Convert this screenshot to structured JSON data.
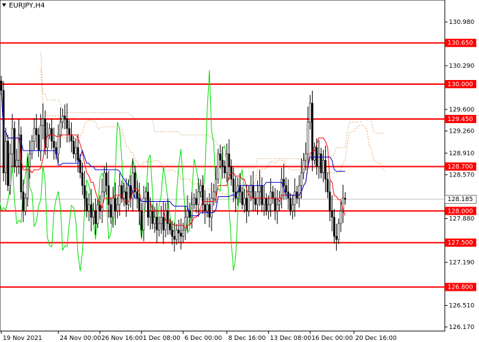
{
  "chart_data": {
    "type": "candlestick",
    "symbol_title": "EURJPY,H4",
    "y_axis": {
      "min": 126.17,
      "max": 131.1,
      "tick_labels": [
        "130.980",
        "130.650",
        "130.290",
        "129.950",
        "129.600",
        "129.260",
        "128.910",
        "128.570",
        "128.220",
        "127.880",
        "127.530",
        "127.190",
        "126.850",
        "126.510",
        "126.170"
      ],
      "side": "right"
    },
    "x_axis": {
      "tick_labels": [
        {
          "label": "19 Nov 2021",
          "index": 0
        },
        {
          "label": "24 Nov 00:00",
          "index": 26
        },
        {
          "label": "26 Nov 16:00",
          "index": 45
        },
        {
          "label": "1 Dec 08:00",
          "index": 64
        },
        {
          "label": "6 Dec 00:00",
          "index": 83
        },
        {
          "label": "8 Dec 16:00",
          "index": 103
        },
        {
          "label": "13 Dec 08:00",
          "index": 122
        },
        {
          "label": "16 Dec 00:00",
          "index": 141
        },
        {
          "label": "20 Dec 16:00",
          "index": 161
        }
      ]
    },
    "levels": [
      {
        "value": 130.65,
        "label": "130.650",
        "color": "#ff0000"
      },
      {
        "value": 130.0,
        "label": "130.000",
        "color": "#ff0000"
      },
      {
        "value": 129.45,
        "label": "129.450",
        "color": "#ff0000"
      },
      {
        "value": 128.7,
        "label": "128.700",
        "color": "#ff0000"
      },
      {
        "value": 128.0,
        "label": "128.000",
        "color": "#ff0000"
      },
      {
        "value": 127.5,
        "label": "127.500",
        "color": "#ff0000"
      },
      {
        "value": 126.8,
        "label": "126.800",
        "color": "#ff0000"
      }
    ],
    "current_price": {
      "value": 128.185,
      "label": "128.185"
    },
    "candle_closes": [
      129.9,
      128.6,
      129.1,
      128.4,
      128.9,
      129.3,
      128.7,
      128.8,
      129.2,
      128.3,
      128.0,
      128.2,
      128.7,
      128.9,
      129.1,
      129.3,
      129.2,
      128.95,
      129.35,
      129.45,
      129.0,
      129.2,
      129.3,
      129.1,
      129.0,
      128.9,
      129.2,
      129.4,
      129.5,
      129.45,
      129.3,
      129.2,
      129.1,
      128.9,
      129.0,
      128.8,
      128.6,
      128.4,
      128.2,
      128.0,
      128.1,
      127.9,
      128.0,
      127.8,
      128.1,
      128.0,
      128.3,
      128.6,
      128.4,
      128.1,
      127.9,
      128.2,
      128.0,
      128.1,
      128.4,
      128.2,
      128.3,
      128.1,
      128.4,
      128.2,
      128.6,
      128.3,
      128.2,
      128.0,
      127.7,
      128.2,
      128.3,
      127.9,
      128.0,
      127.8,
      127.9,
      127.7,
      127.8,
      127.9,
      127.7,
      128.0,
      127.8,
      127.7,
      127.6,
      127.55,
      127.7,
      127.65,
      127.6,
      127.7,
      127.9,
      128.0,
      127.9,
      128.1,
      128.2,
      128.1,
      128.3,
      128.4,
      128.1,
      128.0,
      128.1,
      127.9,
      128.2,
      128.3,
      128.5,
      128.9,
      128.8,
      128.7,
      128.6,
      128.9,
      128.7,
      128.5,
      128.3,
      128.2,
      128.4,
      128.3,
      128.1,
      128.2,
      128.0,
      128.3,
      128.4,
      128.2,
      128.1,
      128.3,
      128.4,
      128.1,
      128.2,
      128.0,
      128.1,
      128.3,
      128.2,
      128.0,
      128.1,
      128.2,
      128.5,
      128.4,
      128.3,
      128.2,
      128.0,
      128.1,
      128.3,
      128.2,
      128.4,
      128.6,
      128.8,
      128.9,
      129.4,
      129.7,
      128.8,
      129.0,
      128.7,
      128.9,
      128.6,
      128.8,
      128.5,
      128.3,
      128.0,
      127.9,
      127.6,
      127.55,
      127.8,
      128.0,
      128.2,
      128.185
    ],
    "series": [
      {
        "name": "tenkan",
        "color": "#ff0000"
      },
      {
        "name": "kijun",
        "color": "#0000cd"
      },
      {
        "name": "chikou",
        "color": "#00dd00"
      },
      {
        "name": "kumo-upper",
        "color": "#d2b48c"
      },
      {
        "name": "kumo-lower",
        "color": "#f4a460"
      }
    ]
  }
}
